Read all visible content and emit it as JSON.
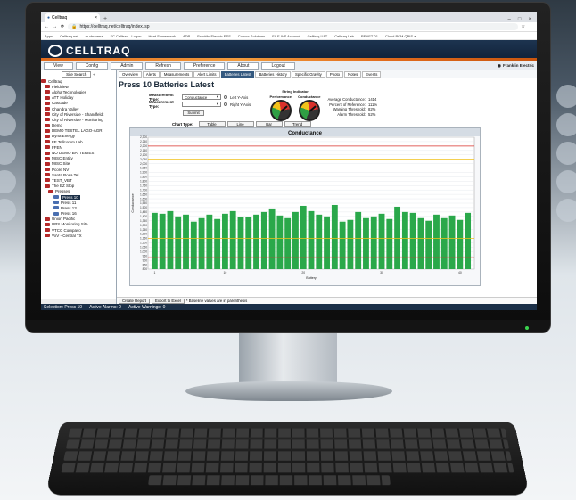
{
  "browser": {
    "tab_title": "Celltraq",
    "new_tab": "+",
    "url": "https://celltraq.net/celltraq/index.jsp",
    "bookmarks": [
      "Apps",
      "Celltraq.net",
      "m.cbreama",
      "FC Celltraq - Logon",
      "Heat Stoneswork",
      "ADP",
      "Franklin Electric ESS",
      "Concur Solutions",
      "FILE IVS Account",
      "Celltraq UAT",
      "Celltraq Lab",
      "RENET-01",
      "Cloud PCM QBIS.a."
    ]
  },
  "app": {
    "logo": "CELLTRAQ",
    "vendor": "Franklin Electric"
  },
  "menu": [
    "View",
    "Config",
    "Admin",
    "Refresh",
    "Preference",
    "About",
    "Logout"
  ],
  "sidebar": {
    "search_label": "Site Search",
    "tree": [
      {
        "label": "Celltraq",
        "type": "root"
      },
      {
        "label": "Fieldview",
        "type": "site"
      },
      {
        "label": "Alpha Technologies",
        "type": "site"
      },
      {
        "label": "ATT Holiday",
        "type": "site"
      },
      {
        "label": "Cascade",
        "type": "site"
      },
      {
        "label": "Chandra Valley",
        "type": "site"
      },
      {
        "label": "City of Riverside - Shandfeldt",
        "type": "site"
      },
      {
        "label": "City of Riverside - Monitoring",
        "type": "site"
      },
      {
        "label": "Demo",
        "type": "site"
      },
      {
        "label": "DEMO TESTEL LAGO-AGR",
        "type": "site"
      },
      {
        "label": "Dyna Energy",
        "type": "site"
      },
      {
        "label": "FE Tellcomm Lab",
        "type": "site"
      },
      {
        "label": "FFEN",
        "type": "site"
      },
      {
        "label": "NO DEMO BATTERIES",
        "type": "site"
      },
      {
        "label": "MISC Entity",
        "type": "site"
      },
      {
        "label": "MISC Site",
        "type": "site"
      },
      {
        "label": "Pcore NV",
        "type": "site"
      },
      {
        "label": "Santa Rosa Tel",
        "type": "site"
      },
      {
        "label": "TEST_VBT",
        "type": "site"
      },
      {
        "label": "The EZ Stop",
        "type": "site"
      },
      {
        "label": "Presses",
        "type": "group"
      },
      {
        "label": "Press 10",
        "type": "selected"
      },
      {
        "label": "Press 11",
        "type": "node"
      },
      {
        "label": "Press 13",
        "type": "node"
      },
      {
        "label": "Press 16",
        "type": "node"
      },
      {
        "label": "Union Pacific",
        "type": "site"
      },
      {
        "label": "UPS Monitoring Site",
        "type": "site"
      },
      {
        "label": "VTCC Compavo",
        "type": "site"
      },
      {
        "label": "VxV - Central TX",
        "type": "site"
      }
    ]
  },
  "tabs": [
    "Overview",
    "Alerts",
    "Measurements",
    "Alert Limits",
    "Batteries Latest",
    "Batteries History",
    "Specific Gravity",
    "Photo",
    "Notes",
    "Events"
  ],
  "active_tab": "Batteries Latest",
  "page_title": "Press 10 Batteries Latest",
  "controls": {
    "measurement_type_label": "Measurement Type:",
    "measurement_type_value": "Conductance",
    "left_axis_label": "Left Y-Axis",
    "measurement_type2_label": "Measurement Type:",
    "measurement_type2_value": "",
    "right_axis_label": "Right Y-Axis",
    "submit_label": "Submit"
  },
  "gauges": {
    "title": "String Indicator",
    "labels": [
      "Performance",
      "Conductance"
    ]
  },
  "stats": [
    {
      "k": "Average Conductance:",
      "v": "1414"
    },
    {
      "k": "Percent of Reference:",
      "v": "111%"
    },
    {
      "k": "Warning Threshold:",
      "v": "82%"
    },
    {
      "k": "Alarm Threshold:",
      "v": "52%"
    }
  ],
  "chart_type": {
    "label": "Chart Type:",
    "options": [
      "Table",
      "Line",
      "Bar",
      "Trend"
    ]
  },
  "bottom": {
    "create_report": "Create Report",
    "export_excel": "Export to Excel",
    "note": "* Baseline values are in parenthesis"
  },
  "status": {
    "selection": "Selection: Press 10",
    "alarms": "Active Alarms: 0",
    "warnings": "Active Warnings: 0"
  },
  "colors": {
    "bar": "#2aa84a",
    "alarm_line": "#d9312b",
    "warning_line": "#f2c21a",
    "accent": "#e06a1c",
    "header": "#1d3450"
  },
  "chart_data": {
    "type": "bar",
    "title": "Conductance",
    "xlabel": "Battery",
    "ylabel": "Conductance",
    "ylim": [
      800,
      2300
    ],
    "yticks": [
      800,
      850,
      900,
      950,
      1000,
      1050,
      1100,
      1150,
      1200,
      1250,
      1300,
      1350,
      1400,
      1450,
      1500,
      1550,
      1600,
      1650,
      1700,
      1750,
      1800,
      1850,
      1900,
      1950,
      2000,
      2050,
      2100,
      2150,
      2200,
      2250,
      2300
    ],
    "xticks": [
      1,
      10,
      20,
      30,
      40
    ],
    "categories": [
      1,
      2,
      3,
      4,
      5,
      6,
      7,
      8,
      9,
      10,
      11,
      12,
      13,
      14,
      15,
      16,
      16,
      17,
      18,
      19,
      20,
      21,
      22,
      23,
      24,
      25,
      26,
      27,
      28,
      29,
      30,
      31,
      32,
      33,
      34,
      35,
      36,
      37,
      38,
      39,
      40
    ],
    "values": [
      1440,
      1430,
      1460,
      1400,
      1420,
      1340,
      1380,
      1420,
      1370,
      1430,
      1460,
      1390,
      1390,
      1420,
      1450,
      1490,
      1410,
      1380,
      1450,
      1520,
      1460,
      1420,
      1400,
      1530,
      1340,
      1360,
      1450,
      1380,
      1400,
      1430,
      1370,
      1510,
      1450,
      1440,
      1380,
      1350,
      1420,
      1380,
      1410,
      1360,
      1440
    ],
    "reference_lines": [
      {
        "name": "Alarm Threshold",
        "value": 2200,
        "color": "#d9312b"
      },
      {
        "name": "Warning Threshold",
        "value": 2050,
        "color": "#f2c21a"
      },
      {
        "name": "Warning Threshold",
        "value": 1150,
        "color": "#f2c21a"
      },
      {
        "name": "Alarm Threshold",
        "value": 930,
        "color": "#d9312b"
      }
    ],
    "grid": true
  }
}
